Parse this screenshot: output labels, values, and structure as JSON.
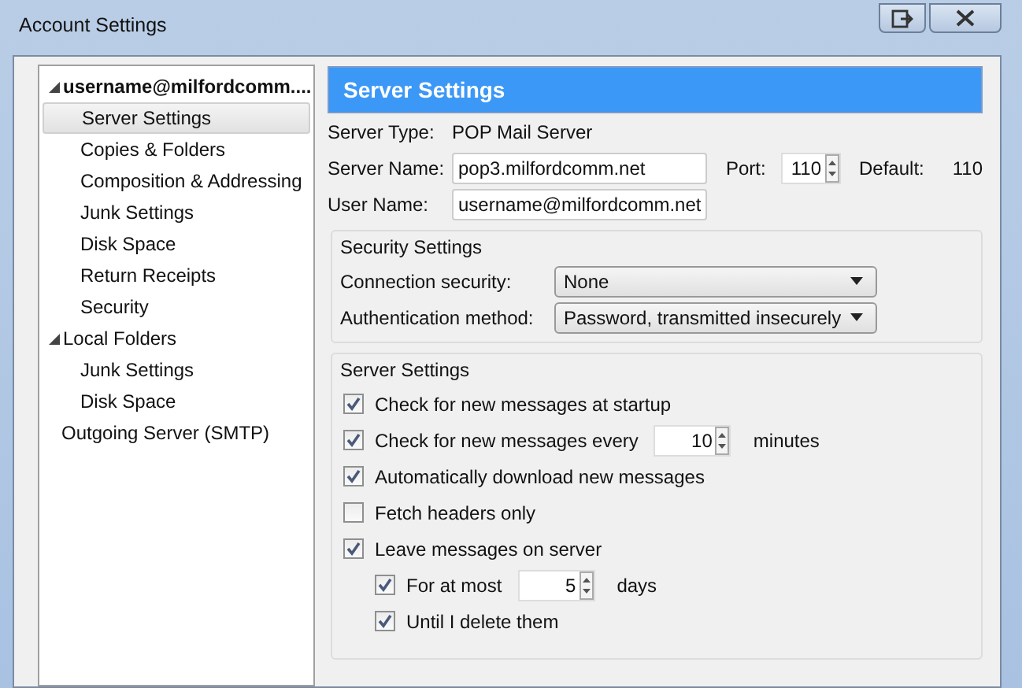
{
  "window": {
    "title": "Account Settings"
  },
  "tree": [
    {
      "label": "username@milfordcomm....",
      "expanded": true,
      "selected": false,
      "bold": true,
      "children": [
        {
          "label": "Server Settings",
          "selected": true
        },
        {
          "label": "Copies & Folders",
          "selected": false
        },
        {
          "label": "Composition & Addressing",
          "selected": false
        },
        {
          "label": "Junk Settings",
          "selected": false
        },
        {
          "label": "Disk Space",
          "selected": false
        },
        {
          "label": "Return Receipts",
          "selected": false
        },
        {
          "label": "Security",
          "selected": false
        }
      ]
    },
    {
      "label": "Local Folders",
      "expanded": true,
      "selected": false,
      "bold": false,
      "children": [
        {
          "label": "Junk Settings",
          "selected": false
        },
        {
          "label": "Disk Space",
          "selected": false
        }
      ]
    },
    {
      "label": "Outgoing Server (SMTP)",
      "selected": false,
      "bold": false
    }
  ],
  "header": "Server Settings",
  "server": {
    "type_label": "Server Type:",
    "type_value": "POP Mail Server",
    "name_label": "Server Name:",
    "name_value": "pop3.milfordcomm.net",
    "port_label": "Port:",
    "port_value": "110",
    "default_label": "Default:",
    "default_value": "110",
    "user_label": "User Name:",
    "user_value": "username@milfordcomm.net"
  },
  "security": {
    "title": "Security Settings",
    "rows": [
      {
        "label": "Connection security:",
        "value": "None"
      },
      {
        "label": "Authentication method:",
        "value": "Password, transmitted insecurely"
      }
    ]
  },
  "settings": {
    "title": "Server Settings",
    "options": [
      {
        "kind": "checkbox",
        "label": "Check for new messages at startup",
        "checked": true
      },
      {
        "kind": "spin",
        "label": "Check for new messages every",
        "checked": true,
        "value": "10",
        "unit": "minutes"
      },
      {
        "kind": "checkbox",
        "label": "Automatically download new messages",
        "checked": true
      },
      {
        "kind": "checkbox",
        "label": "Fetch headers only",
        "checked": false
      },
      {
        "kind": "checkbox",
        "label": "Leave messages on server",
        "checked": true,
        "children": [
          {
            "kind": "spin",
            "label": "For at most",
            "checked": true,
            "value": "5",
            "unit": "days"
          },
          {
            "kind": "checkbox",
            "label": "Until I delete them",
            "checked": true
          }
        ]
      }
    ]
  }
}
